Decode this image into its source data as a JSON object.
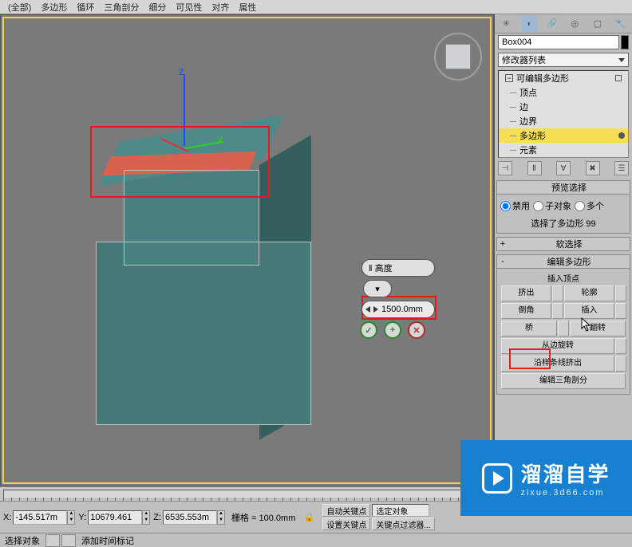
{
  "menu": {
    "items": [
      "(全部)",
      "多边形",
      "循环",
      "三角剖分",
      "细分",
      "可见性",
      "对齐",
      "属性"
    ]
  },
  "caddy": {
    "height_label": "‖ 高度",
    "value": "1500.0mm"
  },
  "panel": {
    "object_name": "Box004",
    "modlist_label": "修改器列表",
    "stack": {
      "root": "可编辑多边形",
      "subs": [
        "顶点",
        "边",
        "边界",
        "多边形",
        "元素"
      ],
      "selected": "多边形"
    },
    "preview": {
      "title": "预览选择",
      "opts": [
        "禁用",
        "子对象",
        "多个"
      ],
      "info": "选择了多边形 99"
    },
    "soft_title": "软选择",
    "edit_title": "编辑多边形",
    "insert_label": "插入顶点",
    "rows": [
      [
        "挤出",
        "轮廓"
      ],
      [
        "倒角",
        "插入"
      ],
      [
        "桥",
        "翻转"
      ]
    ],
    "extra": [
      "从边旋转",
      "沿样条线挤出",
      "编辑三角剖分"
    ]
  },
  "status": {
    "x": "-145.517m",
    "y": "10679.461",
    "z": "6535.553m",
    "grid": "栅格 = 100.0mm",
    "autokey": "自动关键点",
    "selected": "选定对象",
    "setkey": "设置关键点",
    "filter": "关键点过滤器...",
    "select_obj": "选择对象",
    "add_marker": "添加时间标记"
  },
  "watermark": {
    "big": "溜溜自学",
    "small": "zixue.3d66.com"
  }
}
